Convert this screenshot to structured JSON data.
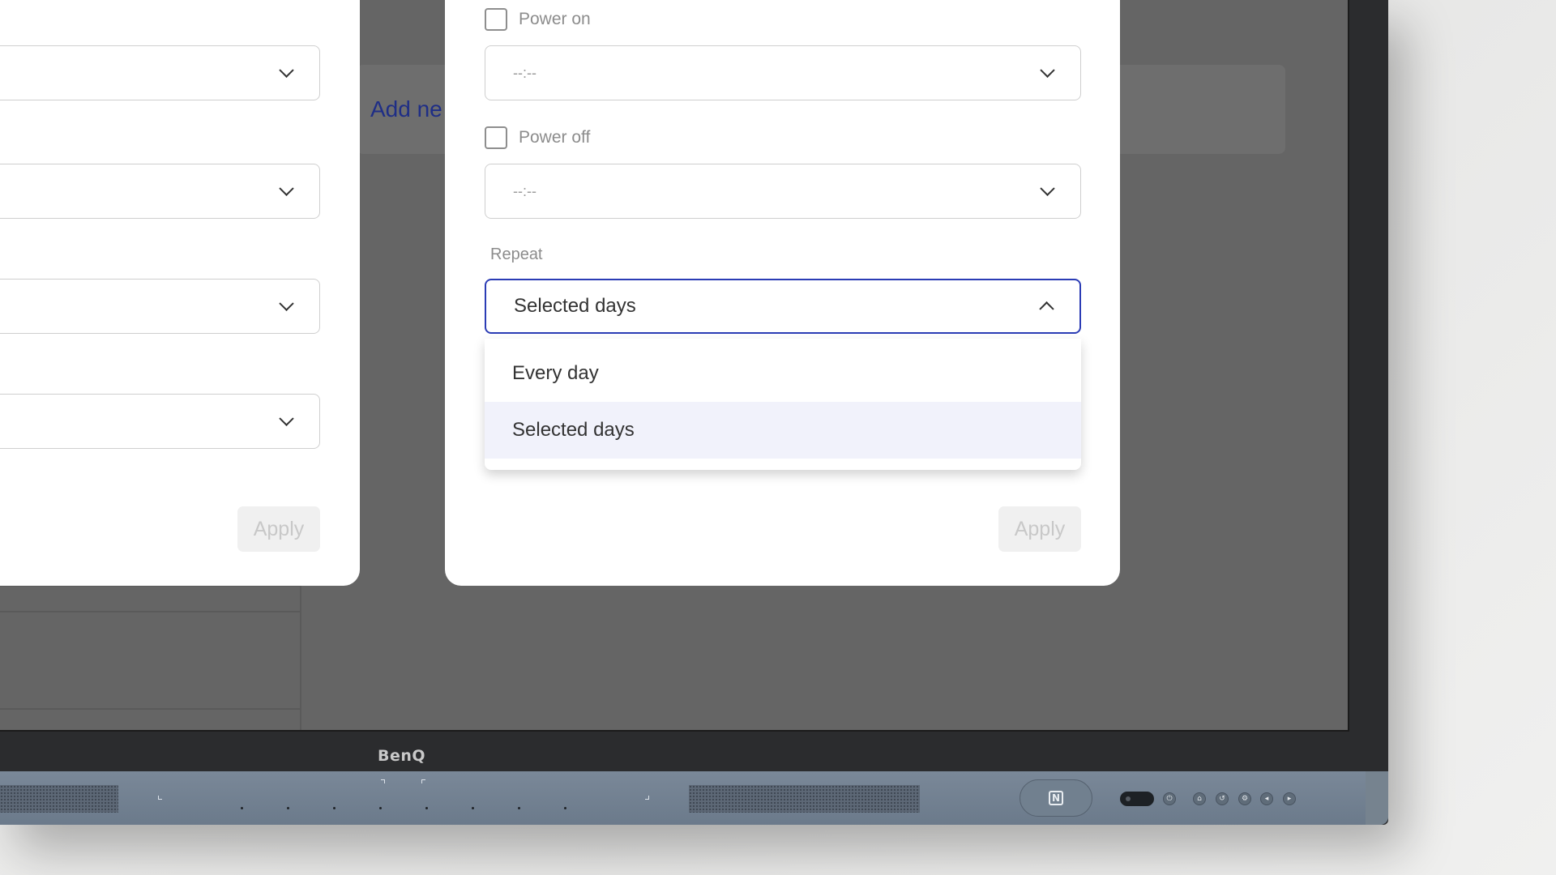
{
  "background": {
    "add_new_label": "Add ne"
  },
  "left_dialog": {
    "apply_label": "Apply"
  },
  "right_dialog": {
    "power_on": {
      "label": "Power on",
      "time_placeholder": "--:--"
    },
    "power_off": {
      "label": "Power off",
      "time_placeholder": "--:--"
    },
    "repeat": {
      "label": "Repeat",
      "selected": "Selected days",
      "options": [
        "Every day",
        "Selected days"
      ]
    },
    "apply_label": "Apply"
  },
  "device": {
    "brand": "BenQ"
  },
  "colors": {
    "accent": "#2b3cb5",
    "overlay": "#656565",
    "link": "#1f2e86"
  }
}
